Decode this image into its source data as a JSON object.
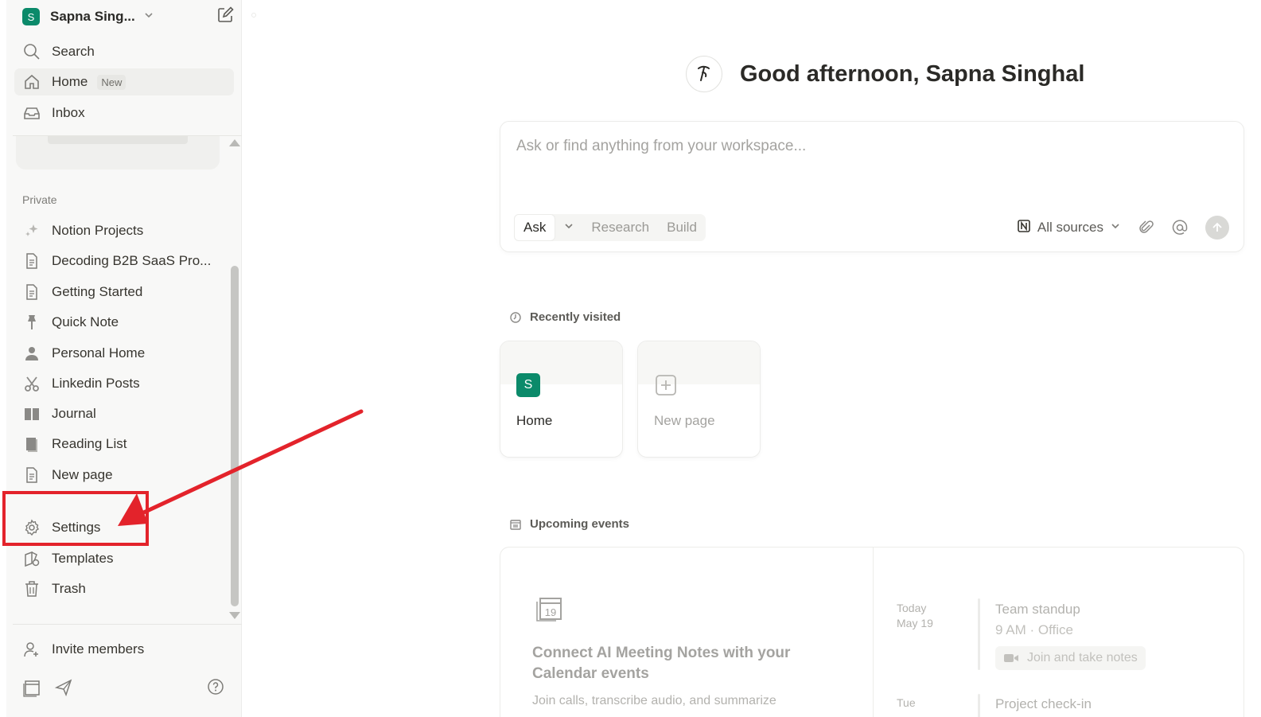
{
  "workspace": {
    "avatar_letter": "S",
    "name": "Sapna Sing...",
    "accent": "#0b8a6a"
  },
  "sidebar": {
    "top_items": [
      {
        "label": "Search",
        "icon": "search-icon"
      },
      {
        "label": "Home",
        "icon": "home-icon",
        "badge": "New",
        "active": true
      },
      {
        "label": "Inbox",
        "icon": "inbox-icon"
      }
    ],
    "section_label": "Private",
    "pages": [
      {
        "label": "Notion Projects",
        "icon": "sparkle-icon"
      },
      {
        "label": "Decoding B2B SaaS Pro...",
        "icon": "page-icon"
      },
      {
        "label": "Getting Started",
        "icon": "page-icon"
      },
      {
        "label": "Quick Note",
        "icon": "pin-icon"
      },
      {
        "label": "Personal Home",
        "icon": "person-icon"
      },
      {
        "label": "Linkedin Posts",
        "icon": "scissors-icon"
      },
      {
        "label": "Journal",
        "icon": "book-icon"
      },
      {
        "label": "Reading List",
        "icon": "books-icon"
      },
      {
        "label": "New page",
        "icon": "page-icon"
      }
    ],
    "utility": [
      {
        "label": "Settings",
        "icon": "gear-icon"
      },
      {
        "label": "Templates",
        "icon": "templates-icon"
      },
      {
        "label": "Trash",
        "icon": "trash-icon"
      }
    ],
    "invite_label": "Invite members"
  },
  "main": {
    "greeting": "Good afternoon, Sapna Singhal",
    "ask": {
      "placeholder": "Ask or find anything from your workspace...",
      "modes": [
        "Ask",
        "Research",
        "Build"
      ],
      "selected_mode": "Ask",
      "sources_label": "All sources"
    },
    "recently_visited": {
      "title": "Recently visited",
      "cards": [
        {
          "label": "Home",
          "icon_letter": "S"
        },
        {
          "label": "New page"
        }
      ]
    },
    "upcoming_events": {
      "title": "Upcoming events",
      "calendar_day": "19",
      "promo_title": "Connect AI Meeting Notes with your Calendar events",
      "promo_desc": "Join calls, transcribe audio, and summarize",
      "events": [
        {
          "day": "Today",
          "date": "May 19",
          "name": "Team standup",
          "meta": "9 AM · Office",
          "join_label": "Join and take notes"
        },
        {
          "day": "Tue",
          "name": "Project check-in"
        }
      ]
    }
  },
  "annotation": {
    "color": "#e3232b"
  }
}
